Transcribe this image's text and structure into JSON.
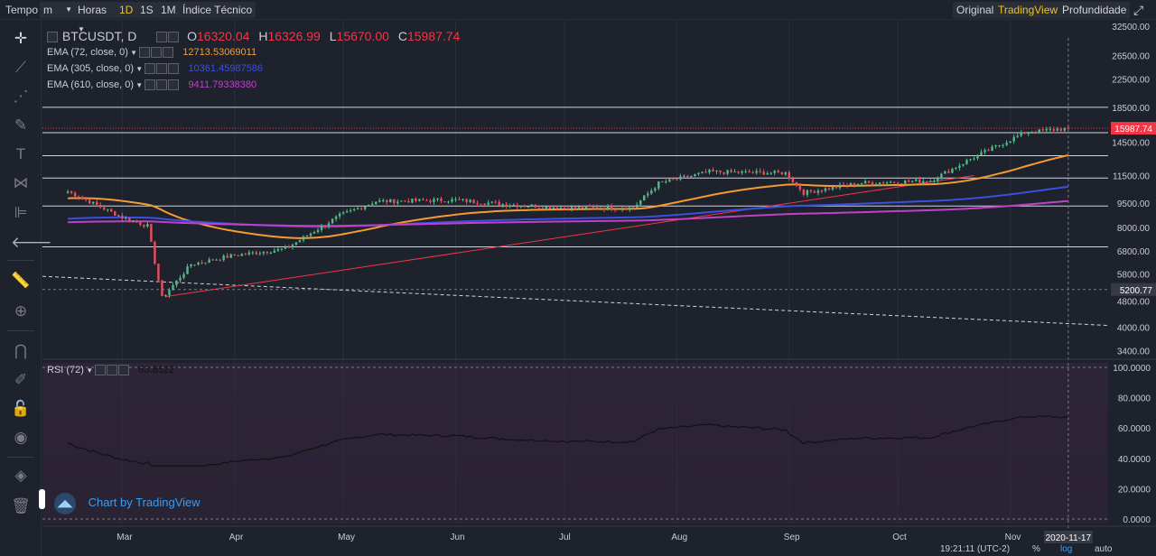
{
  "toolbar": {
    "tempo_label": "Tempo",
    "tempo_value": "m",
    "horas_label": "Horas",
    "interval_1d": "1D",
    "interval_1s": "1S",
    "interval_1m": "1M",
    "indicators_label": "Índice Técnico",
    "view_original": "Original",
    "view_tradingview": "TradingView",
    "view_depth": "Profundidade",
    "active_color": "#f0c419"
  },
  "left_tools": [
    "crosshair-icon",
    "trend-line-icon",
    "fib-icon",
    "brush-icon",
    "text-icon",
    "pattern-icon",
    "measure-icon",
    "back-arrow-icon",
    "ruler-icon",
    "zoom-icon",
    "magnet-icon",
    "lock-draw-icon",
    "lock-icon",
    "eye-icon",
    "layers-icon",
    "trash-icon"
  ],
  "legend": {
    "symbol": "BTCUSDT, D",
    "o_label": "O",
    "o_value": "16320.04",
    "h_label": "H",
    "h_value": "16326.99",
    "l_label": "L",
    "l_value": "15670.00",
    "c_label": "C",
    "c_value": "15987.74",
    "ema72_name": "EMA (72, close, 0)",
    "ema72_value": "12713.53069011",
    "ema72_color": "#f59b2f",
    "ema305_name": "EMA (305, close, 0)",
    "ema305_value": "10361.45987586",
    "ema305_color": "#3b4fe0",
    "ema610_name": "EMA (610, close, 0)",
    "ema610_value": "9411.79338380",
    "ema610_color": "#c040c8",
    "rsi_name": "RSI (72)",
    "rsi_value": "63.8522"
  },
  "price_axis": {
    "ticks": [
      "32500.00",
      "26500.00",
      "22500.00",
      "18500.00",
      "14500.00",
      "11500.00",
      "9500.00",
      "8000.00",
      "6800.00",
      "5800.00",
      "4800.00",
      "4000.00",
      "3400.00"
    ],
    "last_price": "15987.74",
    "last_price_color": "#f23645",
    "marker_price": "5200.77"
  },
  "rsi_axis": {
    "ticks": [
      "100.0000",
      "80.0000",
      "60.0000",
      "40.0000",
      "20.0000",
      "0.0000"
    ]
  },
  "time_axis": {
    "labels": [
      "Mar",
      "Apr",
      "May",
      "Jun",
      "Jul",
      "Aug",
      "Sep",
      "Oct",
      "Nov"
    ],
    "cursor_date": "2020-11-17"
  },
  "bottom": {
    "clock": "19:21:11 (UTC-2)",
    "pct": "%",
    "log": "log",
    "auto": "auto"
  },
  "watermark": "Chart by TradingView",
  "chart_data": {
    "type": "candlestick",
    "symbol": "BTCUSDT",
    "interval": "D",
    "scale": "log",
    "ylim": [
      3200,
      34000
    ],
    "last": {
      "open": 16320.04,
      "high": 16326.99,
      "low": 15670.0,
      "close": 15987.74
    },
    "closes_approx": [
      {
        "x": "2020-02-15",
        "y": 10300
      },
      {
        "x": "2020-03-01",
        "y": 8600
      },
      {
        "x": "2020-03-08",
        "y": 8100
      },
      {
        "x": "2020-03-12",
        "y": 4900
      },
      {
        "x": "2020-03-20",
        "y": 6200
      },
      {
        "x": "2020-04-01",
        "y": 6600
      },
      {
        "x": "2020-04-15",
        "y": 6900
      },
      {
        "x": "2020-04-30",
        "y": 8700
      },
      {
        "x": "2020-05-10",
        "y": 9600
      },
      {
        "x": "2020-06-01",
        "y": 9700
      },
      {
        "x": "2020-06-15",
        "y": 9400
      },
      {
        "x": "2020-07-01",
        "y": 9200
      },
      {
        "x": "2020-07-20",
        "y": 9200
      },
      {
        "x": "2020-07-27",
        "y": 10900
      },
      {
        "x": "2020-08-10",
        "y": 11800
      },
      {
        "x": "2020-08-31",
        "y": 11700
      },
      {
        "x": "2020-09-05",
        "y": 10200
      },
      {
        "x": "2020-09-20",
        "y": 10900
      },
      {
        "x": "2020-10-10",
        "y": 11100
      },
      {
        "x": "2020-10-21",
        "y": 12900
      },
      {
        "x": "2020-11-05",
        "y": 15500
      },
      {
        "x": "2020-11-17",
        "y": 15988
      }
    ],
    "series": [
      {
        "name": "EMA (72, close, 0)",
        "last": 12713.53
      },
      {
        "name": "EMA (305, close, 0)",
        "last": 10361.46
      },
      {
        "name": "EMA (610, close, 0)",
        "last": 9411.79
      }
    ],
    "horizontal_levels": [
      18500,
      15500,
      13200,
      11300,
      9300,
      7000,
      3200
    ],
    "rsi": {
      "name": "RSI (72)",
      "last": 63.8522,
      "ylim": [
        0,
        100
      ]
    }
  }
}
